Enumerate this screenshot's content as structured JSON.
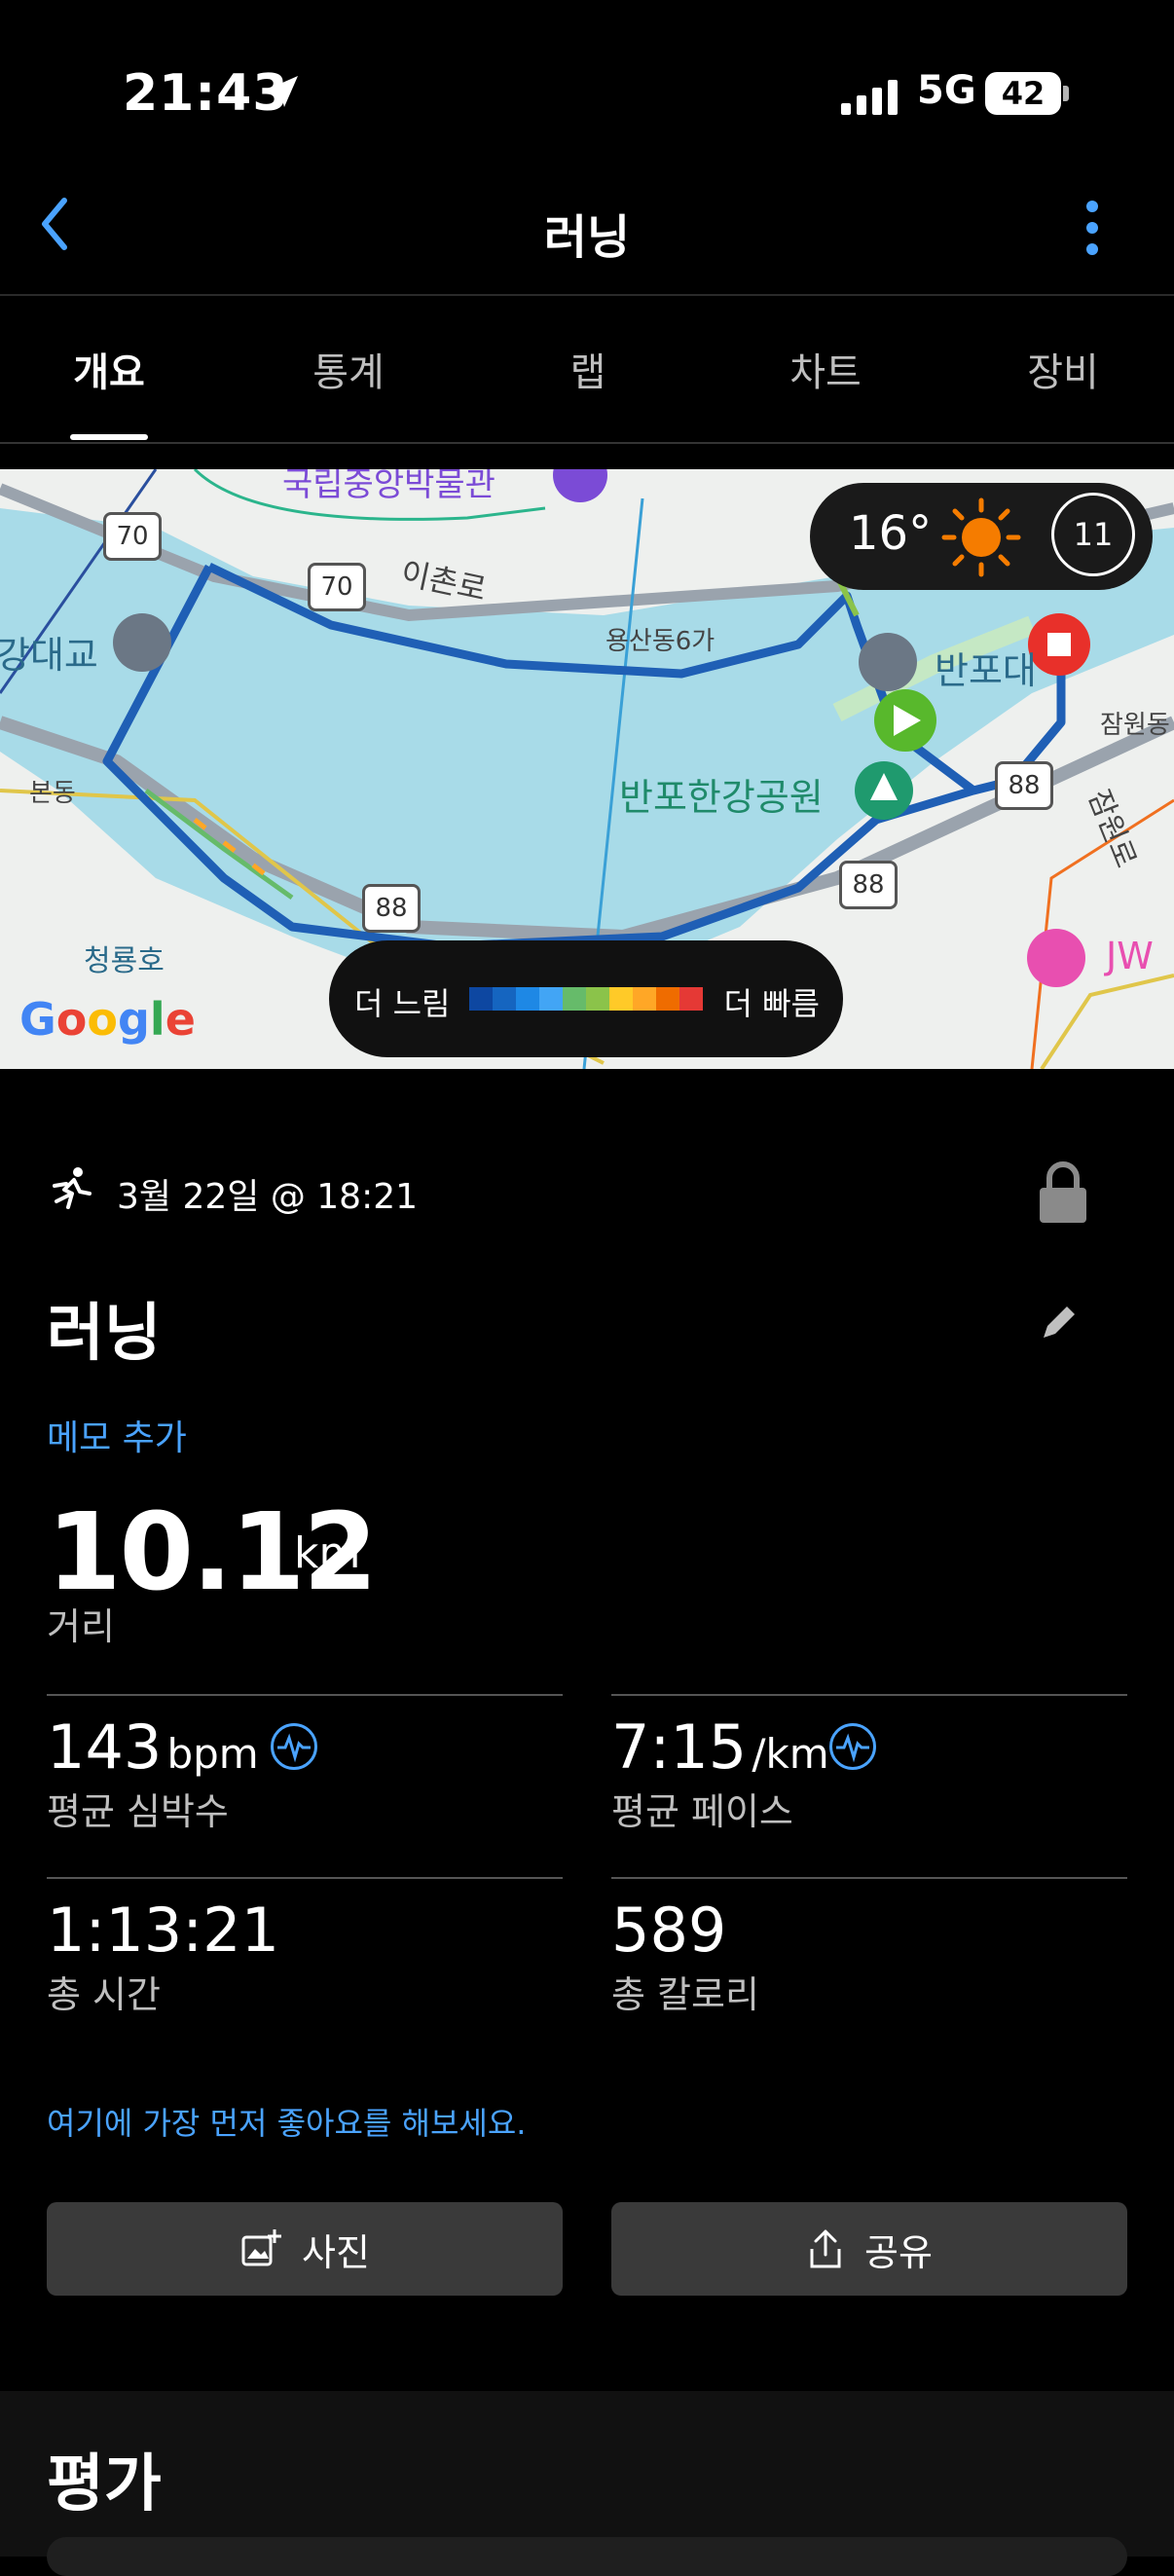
{
  "status_bar": {
    "time": "21:43",
    "network": "5G",
    "battery": "42"
  },
  "nav": {
    "title": "러닝"
  },
  "tabs": [
    {
      "label": "개요",
      "active": true
    },
    {
      "label": "통계",
      "active": false
    },
    {
      "label": "랩",
      "active": false
    },
    {
      "label": "차트",
      "active": false
    },
    {
      "label": "장비",
      "active": false
    }
  ],
  "map": {
    "labels": {
      "ichon": "이촌로",
      "yongsan": "용산동6가",
      "banpo_bridge": "반포대",
      "banpo_park": "반포한강공원",
      "jamwon": "잠원동",
      "jamwonro": "잠원로",
      "bondong": "본동",
      "cheongryong": "청룡호",
      "bridge_left": "강대교",
      "jw": "JW",
      "museum": "국립중앙박물관",
      "road70a": "70",
      "road70b": "70",
      "road88a": "88",
      "road88b": "88",
      "road88c": "88"
    },
    "weather": {
      "temp": "16°",
      "wind": "11"
    },
    "legend": {
      "slow": "더 느림",
      "fast": "더 빠름",
      "colors": [
        "#0d47a1",
        "#1565c0",
        "#1e88e5",
        "#42a5f5",
        "#66bb6a",
        "#8bc34a",
        "#ffca28",
        "#ffa726",
        "#ef6c00",
        "#e53935"
      ]
    },
    "attribution": "Google"
  },
  "activity": {
    "datetime": "3월 22일 @ 18:21",
    "title": "러닝",
    "memo": "메모 추가",
    "distance": "10.12",
    "distance_unit": "km",
    "distance_label": "거리"
  },
  "stats": [
    {
      "value": "143",
      "unit": "bpm",
      "label": "평균 심박수"
    },
    {
      "value": "7:15",
      "unit": "/km",
      "label": "평균 페이스"
    },
    {
      "value": "1:13:21",
      "unit": "",
      "label": "총 시간"
    },
    {
      "value": "589",
      "unit": "",
      "label": "총 칼로리"
    }
  ],
  "like_prompt": "여기에 가장 먼저 좋아요를 해보세요.",
  "buttons": {
    "photo": "사진",
    "share": "공유"
  },
  "section": {
    "rating": "평가"
  },
  "colors": {
    "accent": "#4aa3ff",
    "water": "#a8dbe8",
    "route": "#1f5fb5"
  }
}
